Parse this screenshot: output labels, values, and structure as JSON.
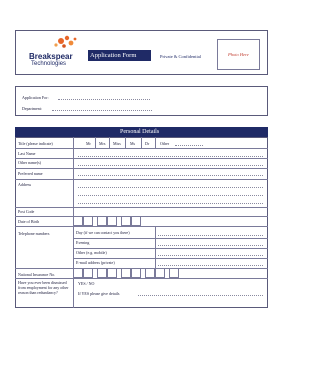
{
  "brand": {
    "name_line1": "Breakspear",
    "name_line2": "Technologies",
    "logo_color": "#e8672a"
  },
  "header": {
    "form_title": "Application Form",
    "confidential": "Private & Confidential",
    "photo_label": "Photo Here",
    "title_bg": "#1f2a66",
    "photo_color": "#c0392b"
  },
  "application": {
    "applied_for_label": "Application For:",
    "department_label": "Department:"
  },
  "personal": {
    "section_title": "Personal Details",
    "title_label": "Title (please indicate)",
    "titles": [
      "Mr",
      "Mrs",
      "Miss",
      "Ms",
      "Dr",
      "Other"
    ],
    "last_name": "Last Name",
    "other_names": "Other name(s)",
    "preferred_name": "Preferred name",
    "address": "Address",
    "post_code": "Post Code",
    "date_of_birth": "Date of Birth",
    "telephone_numbers": "Telephone numbers",
    "day_phone": "Day (if we can contact you there)",
    "evening_phone": "Evening",
    "other_phone": "Other (e.g. mobile)",
    "email": "E-mail address (private)",
    "national_insurance": "National Insurance No.",
    "dismissed_question": "Have you ever been dismissed from employment for any other reason than redundancy?",
    "yes_no": "YES / NO",
    "if_yes": "If YES please give details"
  }
}
